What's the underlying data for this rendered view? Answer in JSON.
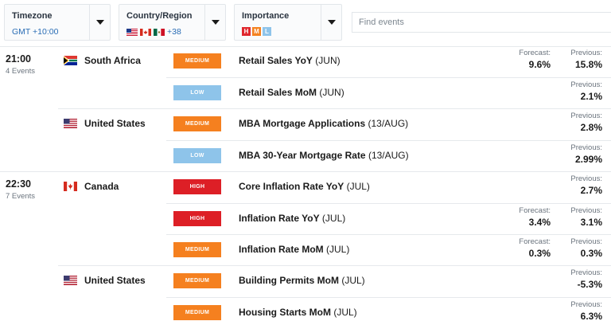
{
  "filters": {
    "timezone": {
      "label": "Timezone",
      "value": "GMT +10:00"
    },
    "country": {
      "label": "Country/Region",
      "extra": "+38"
    },
    "importance": {
      "label": "Importance",
      "chips": [
        "H",
        "M",
        "L"
      ]
    }
  },
  "search": {
    "placeholder": "Find events"
  },
  "groups": [
    {
      "time": "21:00",
      "count": "4 Events",
      "countries": [
        {
          "name": "South Africa",
          "flag": "za-flag-icon",
          "events": [
            {
              "importance": "MEDIUM",
              "name": "Retail Sales YoY",
              "period": "(JUN)",
              "forecast_label": "Forecast:",
              "forecast": "9.6%",
              "previous_label": "Previous:",
              "previous": "15.8%"
            },
            {
              "importance": "LOW",
              "name": "Retail Sales MoM",
              "period": "(JUN)",
              "previous_label": "Previous:",
              "previous": "2.1%"
            }
          ]
        },
        {
          "name": "United States",
          "flag": "us-flag-icon",
          "events": [
            {
              "importance": "MEDIUM",
              "name": "MBA Mortgage Applications",
              "period": "(13/AUG)",
              "previous_label": "Previous:",
              "previous": "2.8%"
            },
            {
              "importance": "LOW",
              "name": "MBA 30-Year Mortgage Rate",
              "period": "(13/AUG)",
              "previous_label": "Previous:",
              "previous": "2.99%"
            }
          ]
        }
      ]
    },
    {
      "time": "22:30",
      "count": "7 Events",
      "countries": [
        {
          "name": "Canada",
          "flag": "ca-flag-icon",
          "events": [
            {
              "importance": "HIGH",
              "name": "Core Inflation Rate YoY",
              "period": "(JUL)",
              "previous_label": "Previous:",
              "previous": "2.7%"
            },
            {
              "importance": "HIGH",
              "name": "Inflation Rate YoY",
              "period": "(JUL)",
              "forecast_label": "Forecast:",
              "forecast": "3.4%",
              "previous_label": "Previous:",
              "previous": "3.1%"
            },
            {
              "importance": "MEDIUM",
              "name": "Inflation Rate MoM",
              "period": "(JUL)",
              "forecast_label": "Forecast:",
              "forecast": "0.3%",
              "previous_label": "Previous:",
              "previous": "0.3%"
            }
          ]
        },
        {
          "name": "United States",
          "flag": "us-flag-icon",
          "events": [
            {
              "importance": "MEDIUM",
              "name": "Building Permits MoM",
              "period": "(JUL)",
              "previous_label": "Previous:",
              "previous": "-5.3%"
            },
            {
              "importance": "MEDIUM",
              "name": "Housing Starts MoM",
              "period": "(JUL)",
              "previous_label": "Previous:",
              "previous": "6.3%"
            }
          ]
        }
      ]
    }
  ],
  "colors": {
    "high": "#dd1f26",
    "medium": "#f5801f",
    "low": "#8ec4ea",
    "link": "#2a6db5"
  }
}
